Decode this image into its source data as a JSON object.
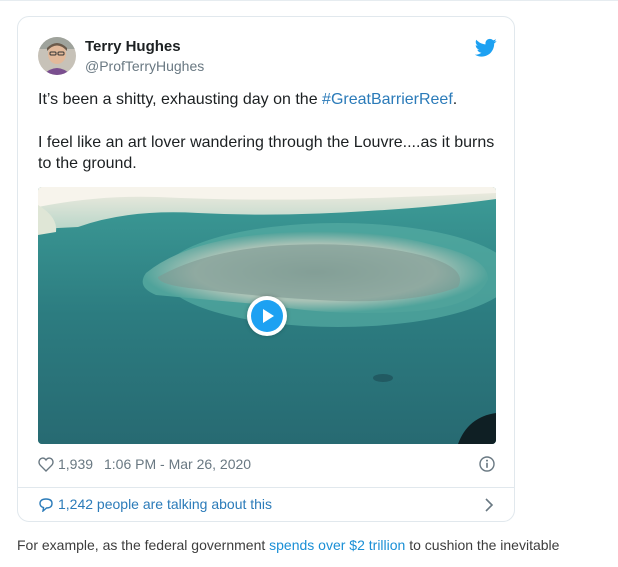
{
  "tweet": {
    "author_name": "Terry Hughes",
    "author_handle": "@ProfTerryHughes",
    "text_line1_prefix": "It’s been a shitty, exhausting day on the ",
    "hashtag": "#GreatBarrierReef",
    "text_line1_suffix": ".",
    "text_line2": "I feel like an art lover wandering through the Louvre....as it burns to the ground.",
    "like_count": "1,939",
    "timestamp": "1:06 PM - Mar 26, 2020",
    "conversation_label": "1,242 people are talking about this"
  },
  "article": {
    "text_before_link": "For example, as the federal government ",
    "link_text": "spends over $2 trillion",
    "text_after_link": " to cushion the inevitable"
  },
  "icons": {
    "twitter_bird": "twitter-bird-icon",
    "play": "play-icon",
    "heart": "heart-icon",
    "info": "info-icon",
    "chat_bubble": "chat-bubble-icon",
    "chevron": "chevron-right-icon"
  },
  "colors": {
    "twitter_blue": "#1da1f2",
    "link_blue": "#2b7bb9",
    "muted_gray": "#697882"
  }
}
